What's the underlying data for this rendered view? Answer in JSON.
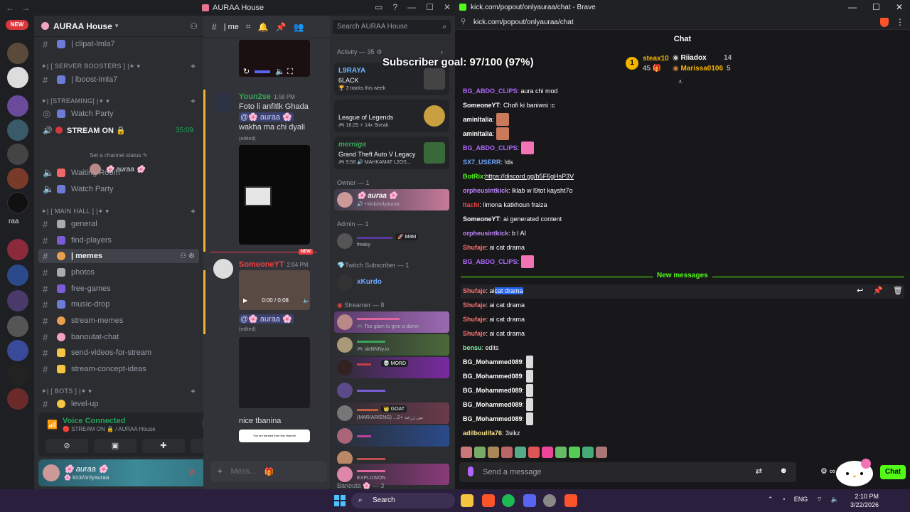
{
  "discord": {
    "window_title": "AURAA House",
    "server_name": "AURAA House",
    "rail_new_badge": "NEW",
    "rail_label": "raa",
    "categories": {
      "server_boosters": "✶| [ SERVER BOOSTERS ] |✶",
      "streaming": "✶| [STREAMING] |✶",
      "main_hall": "✶| [ MAIN HALL ] |✶",
      "bots": "✶| [ BOTS ] |✶"
    },
    "channels": {
      "clipat": "| clipat-lmla7",
      "lboost": "| lboost-lmla7",
      "watch_party_1": "Watch Party",
      "stream_on": "STREAM ON 🔒",
      "stream_time": "35:09",
      "set_status": "Set a channel status ✎",
      "voice_user": "🌸 auraa 🌸",
      "waiting_room": "Waiting Room",
      "watch_party_2": "Watch Party",
      "general": "general",
      "find_players": "find-players",
      "memes": "| memes",
      "photos": "photos",
      "free_games": "free-games",
      "music_drop": "music-drop",
      "stream_memes": "stream-memes",
      "banoutat_chat": "banoutat-chat",
      "send_videos": "send-videos-for-stream",
      "stream_concept": "stream-concept-ideas",
      "level_up": "level-up"
    },
    "voice_panel": {
      "status": "Voice Connected",
      "location": "🔴 STREAM ON 🔒 / AURAA House"
    },
    "user": {
      "name": "🌸 auraa 🌸",
      "status": "🌸 kick/onlyauraa"
    },
    "chat": {
      "header": "| me",
      "msg1_user": "Youn2se",
      "msg1_time": "1:58 PM",
      "msg1_line1": "Foto li anfitlk Ghada",
      "msg1_line2": "@🌸 auraa 🌸",
      "msg1_line3": "wakha ma chi dyali",
      "edited": "(edited)",
      "new_badge": "NEW",
      "msg2_user": "SomeoneYT",
      "msg2_time": "2:04 PM",
      "video_time": "0:00 / 0:08",
      "msg2_mention": "@🌸 auraa 🌸",
      "msg3_text": "nice tbanina",
      "banned_text": "You are banned from this channel",
      "input_placeholder": "Mess..."
    },
    "members": {
      "search_placeholder": "Search AURAA House",
      "activity_header": "Activity — 35",
      "act1_user": "L9RAYA",
      "act1_title": "6LACK",
      "act1_sub": "🏆 3 tracks this week",
      "act2_user": "",
      "act2_title": "League of Legends",
      "act2_sub": "🎮 16:25  ⚡ 14x Streak",
      "act3_user": "merniga",
      "act3_title": "Grand Theft Auto V Legacy",
      "act3_sub": "🎮 9:58  🔊 MAHKAMAT L2OS...",
      "owner_header": "Owner — 1",
      "owner_name": "🌸 auraa 🌸",
      "owner_sub": "🔊 • kick/onlyauraa",
      "admin_header": "Admin — 1",
      "admin_tag": "🚀 M9M",
      "admin_sub": "freaky",
      "twitch_header": "Twitch Subscriber — 1",
      "twitch_member": "xKurdo",
      "streamer_header": "Streamer — 8",
      "s1_sub": "🎮 Too glam to give a damn",
      "s2_sub": "🎮 skINNNy.io",
      "s3_tag": "💀 MORD",
      "s5_tag": "👑 GOAT",
      "s5_sub": "(MAR/AR/ENG) ...ببن زرجه +2",
      "s8_sub": "EXPLOSION",
      "bottom_header": "Banouta 🌸 — 3"
    }
  },
  "brave": {
    "window_title": "kick.com/popout/onlyauraa/chat - Brave",
    "url": "kick.com/popout/onlyauraa/chat",
    "chat_header": "Chat",
    "subscriber_goal": "Subscriber goal: 97/100 (97%)",
    "leaders": {
      "rank": "1",
      "l1_name": "steax10",
      "l1_count": "45",
      "l2_name": "Riiadox",
      "l2_count": "14",
      "l3_name": "Marissa0106",
      "l3_count": "5"
    },
    "messages": [
      {
        "user": "BG_ABDO_CLIPS",
        "text": ": aura chi mod",
        "color": "#b065ff"
      },
      {
        "user": "SomeoneYT",
        "text": ": Chofi ki baniwni :c",
        "color": "#ffffff"
      },
      {
        "user": "aminItalia",
        "text": ":",
        "color": "#ffffff"
      },
      {
        "user": "aminItalia",
        "text": ":",
        "color": "#ffffff"
      },
      {
        "user": "BG_ABDO_CLIPS",
        "text": ":",
        "color": "#b065ff"
      },
      {
        "user": "SX7_USERR",
        "text": ": !ds",
        "color": "#6fa8ff"
      },
      {
        "user": "BotRix",
        "text": ": ",
        "link": "https://discord.gg/b5F6gHsP3V",
        "color": "#53fc18"
      },
      {
        "user": "orpheusintkick",
        "text": ": lklab w l9tot kaysht7o",
        "color": "#c084fc"
      },
      {
        "user": "Itachi",
        "text": ": limona katkhoun fraiza",
        "color": "#ef4444"
      },
      {
        "user": "SomeoneYT",
        "text": ": ai generated content",
        "color": "#ffffff"
      },
      {
        "user": "orpheusintkick",
        "text": ": b l AI",
        "color": "#c084fc"
      },
      {
        "user": "Shufaje",
        "text": ": ai cat drama",
        "color": "#f87171"
      },
      {
        "user": "BG_ABDO_CLIPS",
        "text": ":",
        "color": "#b065ff"
      }
    ],
    "new_messages_label": "New messages",
    "new_messages": [
      {
        "user": "Shufaje",
        "pre": ": ai ",
        "sel": "cat drama",
        "color": "#f87171"
      },
      {
        "user": "Shufaje",
        "text": ": ai cat drama",
        "color": "#f87171"
      },
      {
        "user": "Shufaje",
        "text": ": ai cat drama",
        "color": "#f87171"
      },
      {
        "user": "Shufaje",
        "text": ": ai cat drama",
        "color": "#f87171"
      },
      {
        "user": "bensu",
        "text": ": edits",
        "color": "#86efac"
      },
      {
        "user": "BG_Mohammed089",
        "text": ":",
        "color": "#ffffff"
      },
      {
        "user": "BG_Mohammed089",
        "text": ":",
        "color": "#ffffff"
      },
      {
        "user": "BG_Mohammed089",
        "text": ":",
        "color": "#ffffff"
      },
      {
        "user": "BG_Mohammed089",
        "text": ":",
        "color": "#ffffff"
      },
      {
        "user": "BG_Mohammed089",
        "text": ":",
        "color": "#ffffff"
      },
      {
        "user": "adilboulifa76",
        "text": ": 3sikz",
        "color": "#fde68a"
      }
    ],
    "input_placeholder": "Send a message",
    "chat_button": "Chat"
  },
  "taskbar": {
    "search": "Search",
    "lang": "ENG",
    "time": "2:10 PM",
    "date": "3/22/2026"
  },
  "colors": {
    "kick_green": "#53fc18",
    "discord_bg": "#313338",
    "discord_sidebar": "#2b2d31",
    "kick_bg": "#18181b"
  }
}
